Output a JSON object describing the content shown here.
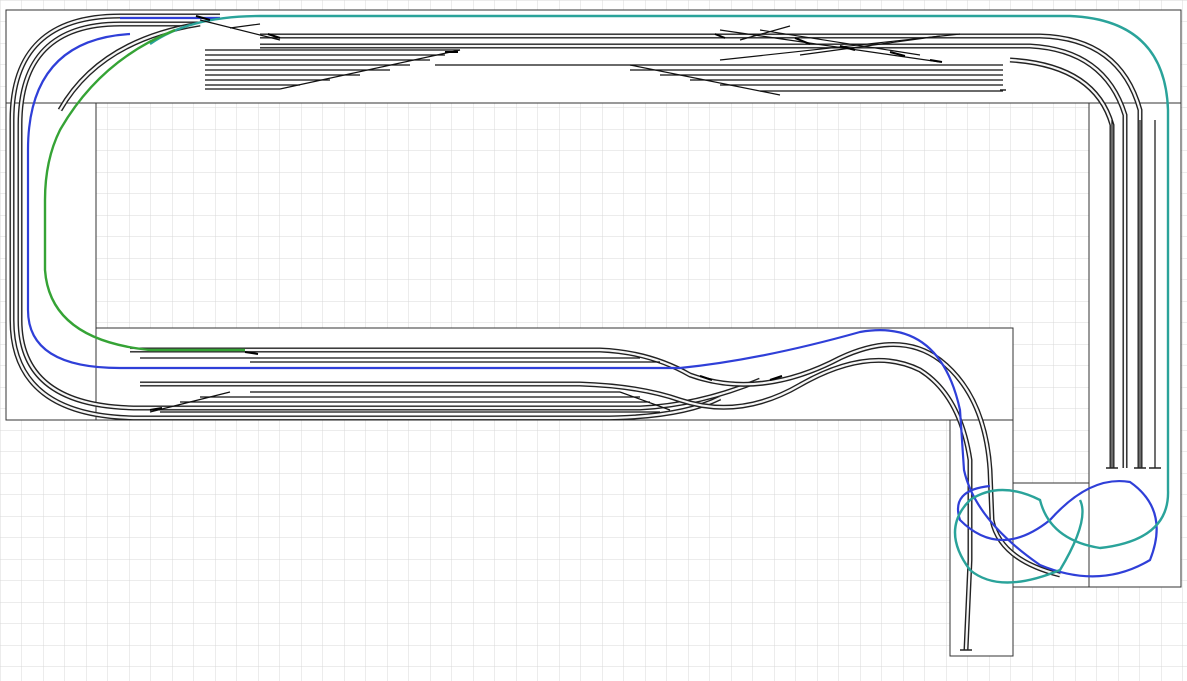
{
  "diagram": {
    "kind": "model railroad track plan",
    "colors": {
      "grid": "#d9d9d9",
      "board_outline": "#333333",
      "track": "#222222",
      "route_blue": "#2f3fd8",
      "route_cyan": "#2aa39a",
      "route_green": "#35a335"
    },
    "routes": [
      {
        "id": "blue",
        "color": "#2f3fd8"
      },
      {
        "id": "cyan",
        "color": "#2aa39a"
      },
      {
        "id": "green",
        "color": "#35a335"
      }
    ]
  }
}
